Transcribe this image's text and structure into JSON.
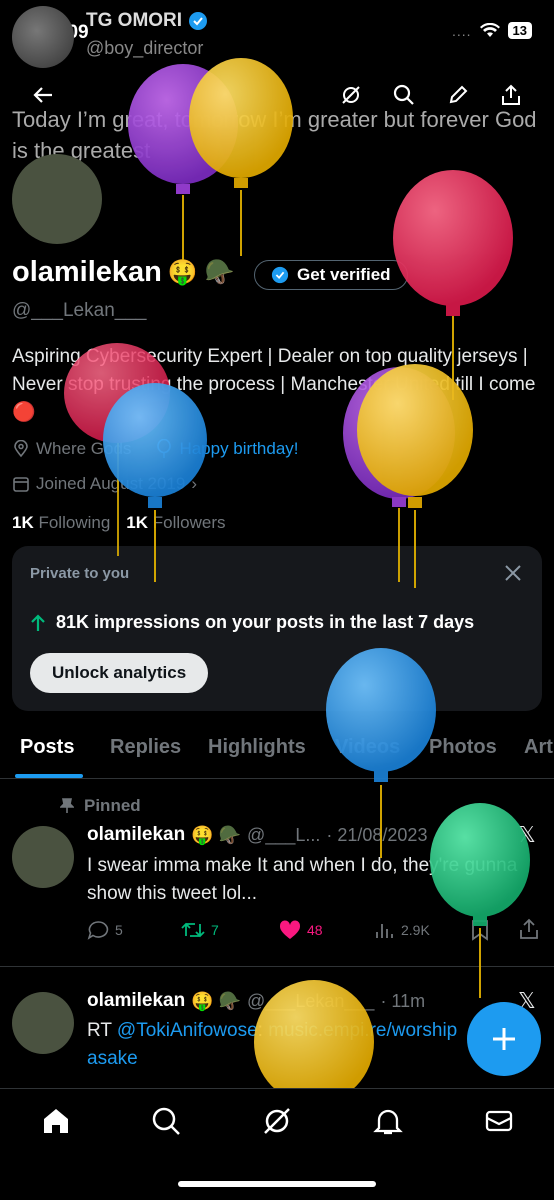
{
  "status": {
    "time": "12:09",
    "signal": "....",
    "battery": "13"
  },
  "header": {
    "name": "TG OMORI",
    "handle": "@boy_director"
  },
  "banner": {
    "text": "Today I’m great, tomorrow I’m greater but forever God is the greatest"
  },
  "profile": {
    "display_name": "olamilekan",
    "name_emoji": "🤑 🪖",
    "get_verified": "Get verified",
    "handle": "@___Lekan___",
    "bio": "Aspiring Cybersecurity Expert | Dealer on top quality jerseys | Never stop trusting the process | Manchester United till I come 🔴",
    "location": "Where Gods",
    "birthday": "Happy birthday!",
    "joined": "Joined August 2019",
    "following_count": "1K",
    "following_label": "Following",
    "followers_count": "1K",
    "followers_label": "Followers"
  },
  "private_card": {
    "title": "Private to you",
    "impressions": "81K impressions on your posts in the last 7 days",
    "button": "Unlock analytics"
  },
  "tabs": [
    "Posts",
    "Replies",
    "Highlights",
    "Videos",
    "Photos",
    "Art"
  ],
  "posts": [
    {
      "pinned_label": "Pinned",
      "name": "olamilekan",
      "emoji": "🤑 🪖",
      "handle": "@___L...",
      "date": "· 21/08/2023",
      "text": "I swear imma make It and when I do, they're gunna show this tweet lol...",
      "replies": "5",
      "reposts": "7",
      "likes": "48",
      "views": "2.9K"
    },
    {
      "name": "olamilekan",
      "emoji": "🤑 🪖",
      "handle": "@___Lekan___",
      "date": "· 11m",
      "text_prefix": "RT ",
      "mention": "@TokiAnifowose",
      "text_suffix": ": ",
      "link": "music.empi.re/worshipasake"
    }
  ],
  "colors": {
    "accent": "#1d9bf0",
    "like": "#f91880",
    "repost": "#00ba7c",
    "card": "#16181c"
  }
}
